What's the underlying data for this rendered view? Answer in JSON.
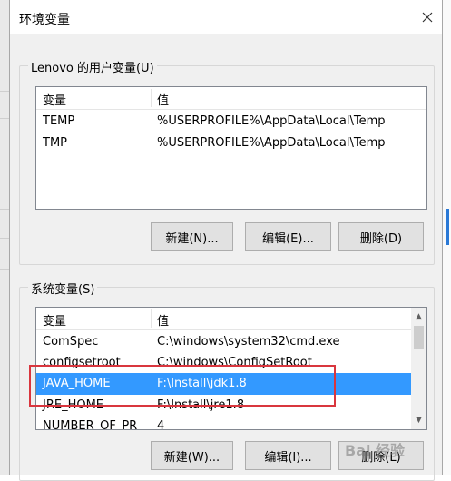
{
  "dialog": {
    "title": "环境变量"
  },
  "user_vars": {
    "group_label": "Lenovo 的用户变量(U)",
    "columns": [
      "变量",
      "值"
    ],
    "rows": [
      {
        "name": "TEMP",
        "value": "%USERPROFILE%\\AppData\\Local\\Temp"
      },
      {
        "name": "TMP",
        "value": "%USERPROFILE%\\AppData\\Local\\Temp"
      }
    ],
    "buttons": {
      "new": "新建(N)...",
      "edit": "编辑(E)...",
      "delete": "删除(D)"
    }
  },
  "system_vars": {
    "group_label": "系统变量(S)",
    "columns": [
      "变量",
      "值"
    ],
    "rows": [
      {
        "name": "ComSpec",
        "value": "C:\\windows\\system32\\cmd.exe"
      },
      {
        "name": "configsetroot",
        "value": "C:\\windows\\ConfigSetRoot"
      },
      {
        "name": "JAVA_HOME",
        "value": "F:\\Install\\jdk1.8"
      },
      {
        "name": "JRE_HOME",
        "value": "F:\\Install\\jre1.8"
      },
      {
        "name": "NUMBER_OF_PR",
        "value": "4"
      }
    ],
    "buttons": {
      "new": "新建(W)...",
      "edit": "编辑(I)...",
      "delete": "删除(L)"
    }
  },
  "watermark": {
    "text": "Bai 经验"
  },
  "colors": {
    "selection": "#3399ff",
    "highlight_box": "#d9363e"
  }
}
